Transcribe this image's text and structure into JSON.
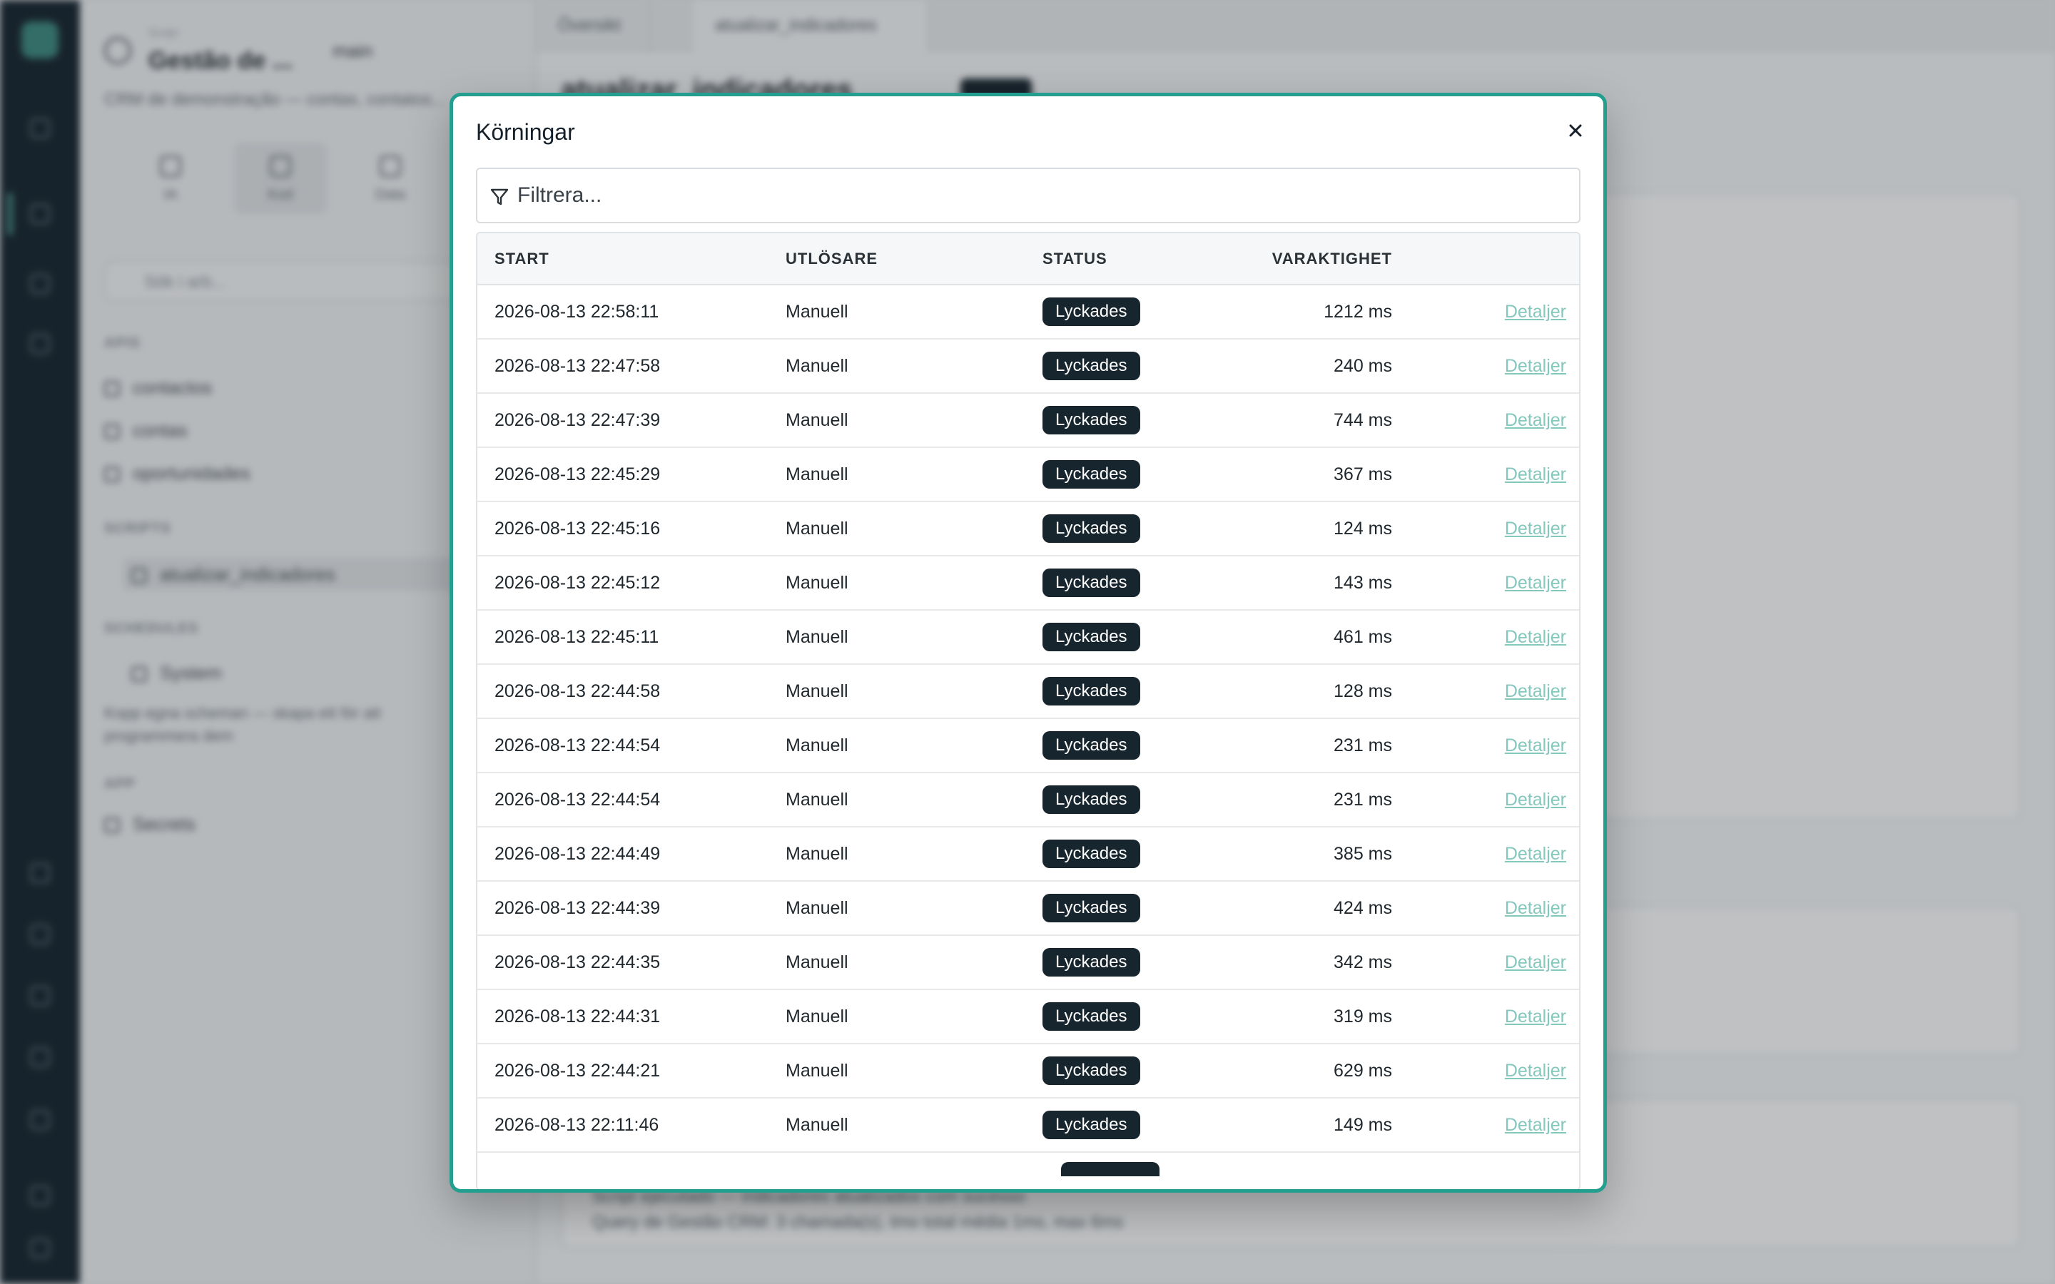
{
  "background": {
    "panel_header_sub": "Script",
    "panel_title": "Gestão de ...",
    "branch": "main",
    "panel_description": "CRM de demonstração — contas, contatos...",
    "panel_tabs": [
      "IA",
      "Kod",
      "Data"
    ],
    "search_placeholder": "Sök i arb...",
    "sections": {
      "apis": "APIS",
      "scripts": "SCRIPTS",
      "schedules": "SCHEDULES",
      "app": "APP"
    },
    "api_items": [
      "contactos",
      "contas",
      "oportunidades"
    ],
    "script_items": [
      "atualizar_indicadores"
    ],
    "schedule_item": "System",
    "schedule_note": "Kopp egna scheman — skapa ett för att programmera dem",
    "app_items": [
      "Secrets"
    ],
    "main_tabs": [
      "Översikt",
      "atualizar_indicadores"
    ],
    "main_title": "atualizar_indicadores",
    "main_title_meta": "Python",
    "main_lines": [
      "Script ejecutado — indicadores atualizados com sucesso",
      "Query de Gestão CRM: 3 chamada(s), tmo total média 1ms, max 6ms"
    ]
  },
  "modal": {
    "title": "Körningar",
    "filter_placeholder": "Filtrera...",
    "columns": {
      "start": "START",
      "trigger": "UTLÖSARE",
      "status": "STATUS",
      "duration": "VARAKTIGHET"
    },
    "details_label": "Detaljer",
    "rows": [
      {
        "start": "2026-08-13 22:58:11",
        "trigger": "Manuell",
        "status": "Lyckades",
        "duration": "1212 ms"
      },
      {
        "start": "2026-08-13 22:47:58",
        "trigger": "Manuell",
        "status": "Lyckades",
        "duration": "240 ms"
      },
      {
        "start": "2026-08-13 22:47:39",
        "trigger": "Manuell",
        "status": "Lyckades",
        "duration": "744 ms"
      },
      {
        "start": "2026-08-13 22:45:29",
        "trigger": "Manuell",
        "status": "Lyckades",
        "duration": "367 ms"
      },
      {
        "start": "2026-08-13 22:45:16",
        "trigger": "Manuell",
        "status": "Lyckades",
        "duration": "124 ms"
      },
      {
        "start": "2026-08-13 22:45:12",
        "trigger": "Manuell",
        "status": "Lyckades",
        "duration": "143 ms"
      },
      {
        "start": "2026-08-13 22:45:11",
        "trigger": "Manuell",
        "status": "Lyckades",
        "duration": "461 ms"
      },
      {
        "start": "2026-08-13 22:44:58",
        "trigger": "Manuell",
        "status": "Lyckades",
        "duration": "128 ms"
      },
      {
        "start": "2026-08-13 22:44:54",
        "trigger": "Manuell",
        "status": "Lyckades",
        "duration": "231 ms"
      },
      {
        "start": "2026-08-13 22:44:54",
        "trigger": "Manuell",
        "status": "Lyckades",
        "duration": "231 ms"
      },
      {
        "start": "2026-08-13 22:44:49",
        "trigger": "Manuell",
        "status": "Lyckades",
        "duration": "385 ms"
      },
      {
        "start": "2026-08-13 22:44:39",
        "trigger": "Manuell",
        "status": "Lyckades",
        "duration": "424 ms"
      },
      {
        "start": "2026-08-13 22:44:35",
        "trigger": "Manuell",
        "status": "Lyckades",
        "duration": "342 ms"
      },
      {
        "start": "2026-08-13 22:44:31",
        "trigger": "Manuell",
        "status": "Lyckades",
        "duration": "319 ms"
      },
      {
        "start": "2026-08-13 22:44:21",
        "trigger": "Manuell",
        "status": "Lyckades",
        "duration": "629 ms"
      },
      {
        "start": "2026-08-13 22:11:46",
        "trigger": "Manuell",
        "status": "Lyckades",
        "duration": "149 ms"
      }
    ]
  },
  "colors": {
    "modal_border": "#239e8f",
    "badge_bg": "#17252e",
    "link": "#84c7bd",
    "rail_bg": "#17252e"
  },
  "icons": {
    "close": "close-icon",
    "filter": "filter-icon"
  }
}
